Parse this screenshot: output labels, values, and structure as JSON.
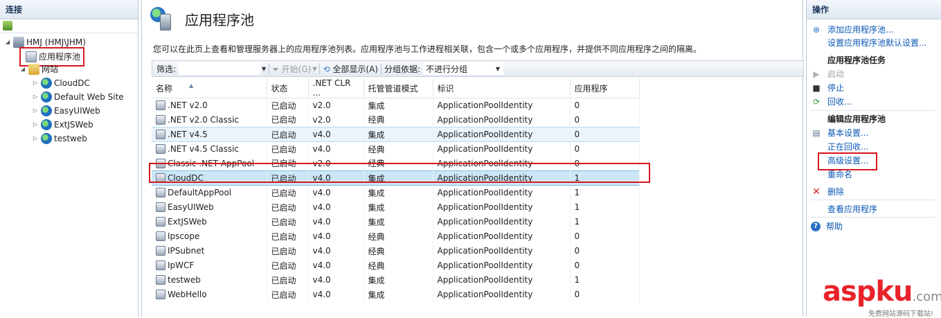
{
  "connections": {
    "title": "连接",
    "tree": {
      "server": "HMJ (HMJ\\JHM)",
      "app_pools": "应用程序池",
      "sites_folder": "网站",
      "sites": [
        "CloudDC",
        "Default Web Site",
        "EasyUIWeb",
        "ExtJSWeb",
        "testweb"
      ]
    }
  },
  "main": {
    "title": "应用程序池",
    "description": "您可以在此页上查看和管理服务器上的应用程序池列表。应用程序池与工作进程相关联，包含一个或多个应用程序，并提供不同应用程序之间的隔离。",
    "filter": {
      "label": "筛选:",
      "value": "",
      "start_label": "开始(G)",
      "show_all_label": "全部显示(A)",
      "group_label": "分组依据:",
      "group_value": "不进行分组"
    },
    "columns": [
      "名称",
      "状态",
      ".NET CLR ...",
      "托管管道模式",
      "标识",
      "应用程序"
    ],
    "rows": [
      {
        "name": ".NET v2.0",
        "status": "已启动",
        "clr": "v2.0",
        "pipeline": "集成",
        "identity": "ApplicationPoolIdentity",
        "apps": "0"
      },
      {
        "name": ".NET v2.0 Classic",
        "status": "已启动",
        "clr": "v2.0",
        "pipeline": "经典",
        "identity": "ApplicationPoolIdentity",
        "apps": "0"
      },
      {
        "name": ".NET v4.5",
        "status": "已启动",
        "clr": "v4.0",
        "pipeline": "集成",
        "identity": "ApplicationPoolIdentity",
        "apps": "0"
      },
      {
        "name": ".NET v4.5 Classic",
        "status": "已启动",
        "clr": "v4.0",
        "pipeline": "经典",
        "identity": "ApplicationPoolIdentity",
        "apps": "0"
      },
      {
        "name": "Classic .NET AppPool",
        "status": "已启动",
        "clr": "v2.0",
        "pipeline": "经典",
        "identity": "ApplicationPoolIdentity",
        "apps": "0"
      },
      {
        "name": "CloudDC",
        "status": "已启动",
        "clr": "v4.0",
        "pipeline": "集成",
        "identity": "ApplicationPoolIdentity",
        "apps": "1"
      },
      {
        "name": "DefaultAppPool",
        "status": "已启动",
        "clr": "v4.0",
        "pipeline": "集成",
        "identity": "ApplicationPoolIdentity",
        "apps": "1"
      },
      {
        "name": "EasyUIWeb",
        "status": "已启动",
        "clr": "v4.0",
        "pipeline": "集成",
        "identity": "ApplicationPoolIdentity",
        "apps": "1"
      },
      {
        "name": "ExtJSWeb",
        "status": "已启动",
        "clr": "v4.0",
        "pipeline": "集成",
        "identity": "ApplicationPoolIdentity",
        "apps": "1"
      },
      {
        "name": "Ipscope",
        "status": "已启动",
        "clr": "v4.0",
        "pipeline": "经典",
        "identity": "ApplicationPoolIdentity",
        "apps": "0"
      },
      {
        "name": "IPSubnet",
        "status": "已启动",
        "clr": "v4.0",
        "pipeline": "经典",
        "identity": "ApplicationPoolIdentity",
        "apps": "0"
      },
      {
        "name": "IpWCF",
        "status": "已启动",
        "clr": "v4.0",
        "pipeline": "经典",
        "identity": "ApplicationPoolIdentity",
        "apps": "0"
      },
      {
        "name": "testweb",
        "status": "已启动",
        "clr": "v4.0",
        "pipeline": "集成",
        "identity": "ApplicationPoolIdentity",
        "apps": "1"
      },
      {
        "name": "WebHello",
        "status": "已启动",
        "clr": "v4.0",
        "pipeline": "集成",
        "identity": "ApplicationPoolIdentity",
        "apps": "0"
      }
    ]
  },
  "actions": {
    "title": "操作",
    "add_pool": "添加应用程序池...",
    "set_defaults": "设置应用程序池默认设置...",
    "tasks_header": "应用程序池任务",
    "start": "启动",
    "stop": "停止",
    "recycle": "回收...",
    "edit_header": "编辑应用程序池",
    "basic_settings": "基本设置...",
    "recycling": "正在回收...",
    "advanced_settings": "高级设置...",
    "rename": "重命名",
    "delete": "删除",
    "view_apps": "查看应用程序",
    "help": "帮助"
  },
  "watermark": {
    "brand": "aspku",
    "suffix": ".com",
    "tagline": "免费网站源码下载站!"
  },
  "colors": {
    "accent": "#0a58b5",
    "selection_outline": "#d7161d",
    "selected_row": "#cce6f7"
  }
}
